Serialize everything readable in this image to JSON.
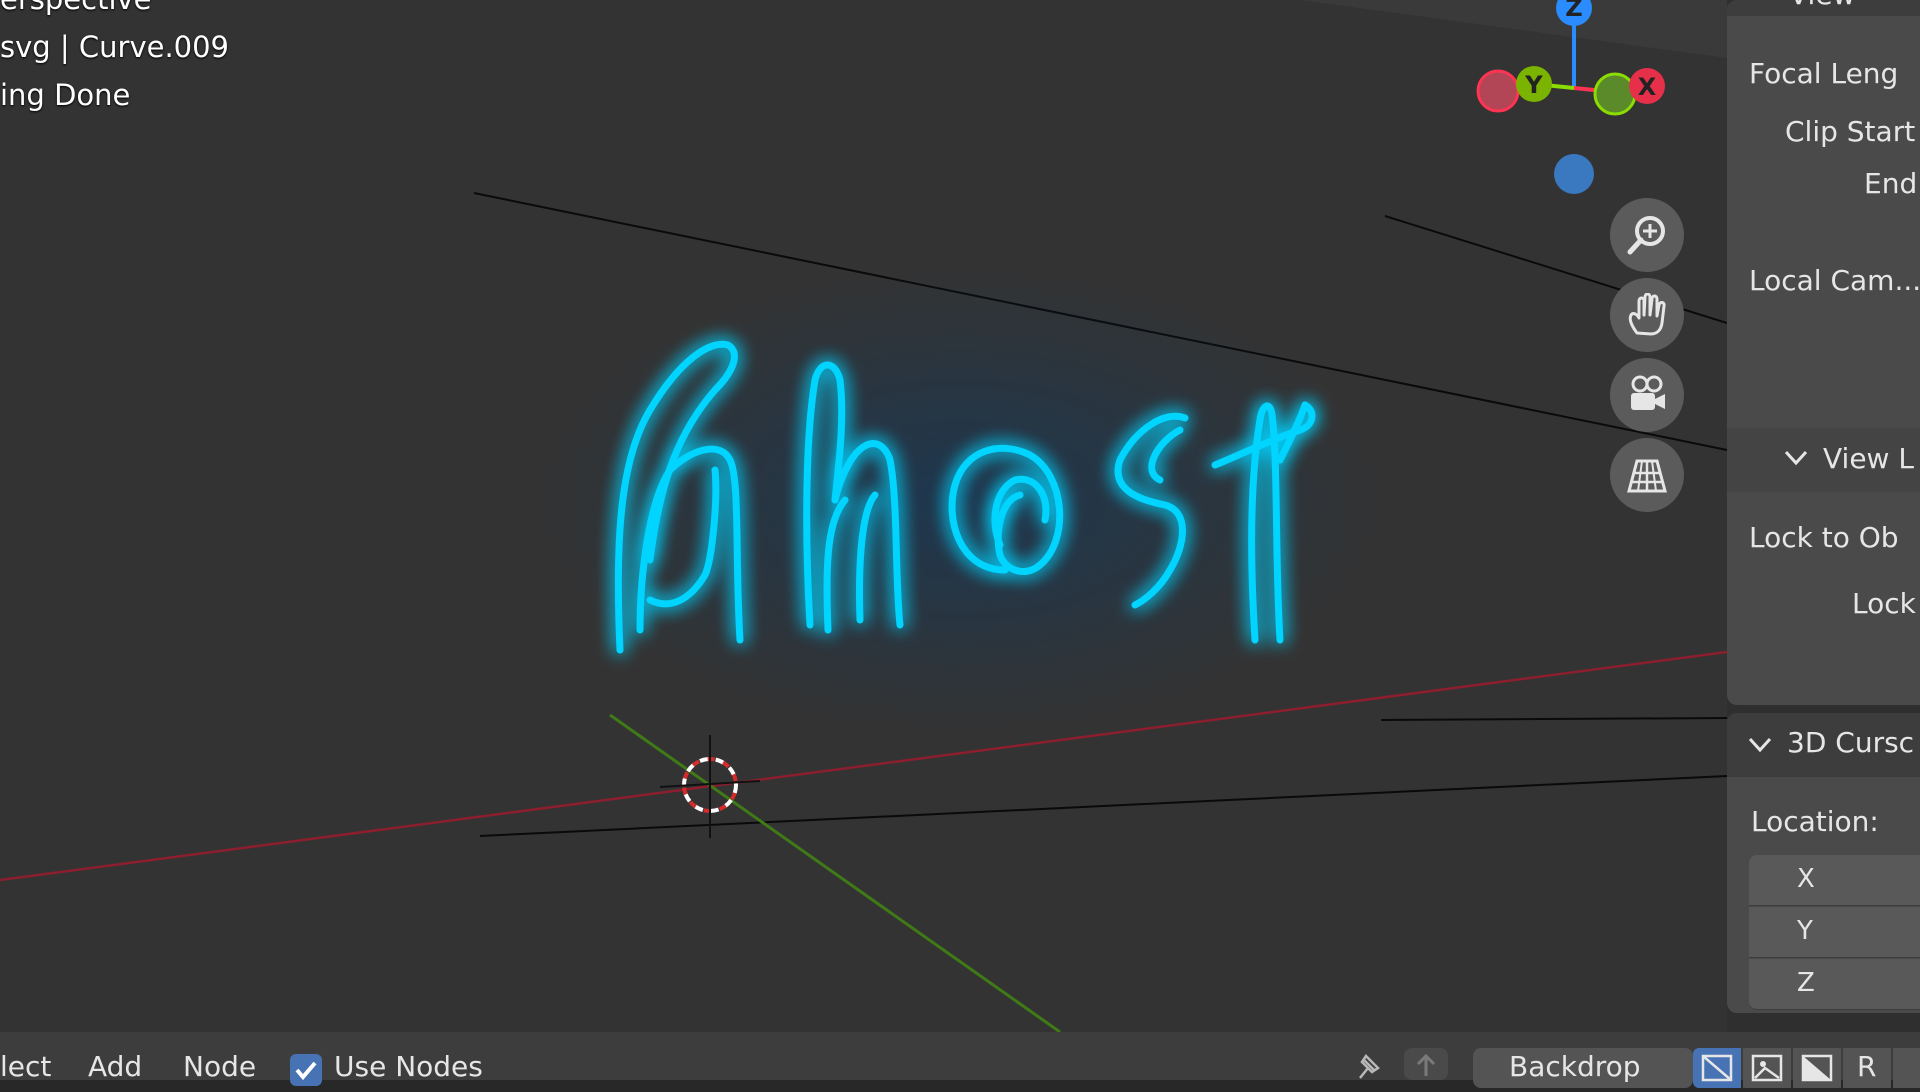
{
  "viewport": {
    "overlay": [
      "erspective",
      "svg | Curve.009",
      "ing Done"
    ],
    "neon_text": "Ghost",
    "gizmo_axes": {
      "z": "Z",
      "y": "Y",
      "x": "X"
    },
    "colors": {
      "neon": "#00cfff",
      "x_axis": "#ff3352",
      "y_axis": "#8bdc00",
      "z_axis": "#2b8cff"
    }
  },
  "nav_tools": [
    {
      "icon": "zoom-in-icon"
    },
    {
      "icon": "hand-pan-icon"
    },
    {
      "icon": "camera-icon"
    },
    {
      "icon": "perspective-grid-icon"
    }
  ],
  "sidebar": {
    "view_panel": {
      "title": "View",
      "focal_length": "Focal Leng",
      "clip_start": "Clip Start",
      "clip_end": "End",
      "local_camera": "Local Cam...",
      "view_lock_title": "View L",
      "lock_to_object": "Lock to Ob",
      "lock": "Lock"
    },
    "cursor_panel": {
      "title": "3D Cursc",
      "location_label": "Location:",
      "axes": [
        "X",
        "Y",
        "Z"
      ]
    }
  },
  "bottombar": {
    "menu": [
      "lect",
      "Add",
      "Node"
    ],
    "use_nodes": "Use Nodes",
    "backdrop": "Backdrop",
    "r_label": "R"
  }
}
